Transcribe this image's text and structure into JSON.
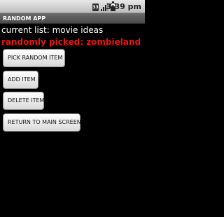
{
  "status_bar": {
    "icons": [
      "notification-33-icon",
      "signal-icon",
      "battery-icon"
    ],
    "notification_label": "33",
    "signal_strength": 0.75,
    "battery_level": 0.6,
    "time": "3:39 pm"
  },
  "app": {
    "title": "RANDOM APP"
  },
  "main": {
    "current_list": "current list: movie ideas",
    "picked": "randomly picked: zombieland",
    "picked_color": "#e01818"
  },
  "buttons": {
    "pick_random": "PICK RANDOM ITEM",
    "add_item": "ADD ITEM",
    "delete_item": "DELETE ITEM",
    "return_main": "RETURN TO MAIN SCREEN"
  }
}
